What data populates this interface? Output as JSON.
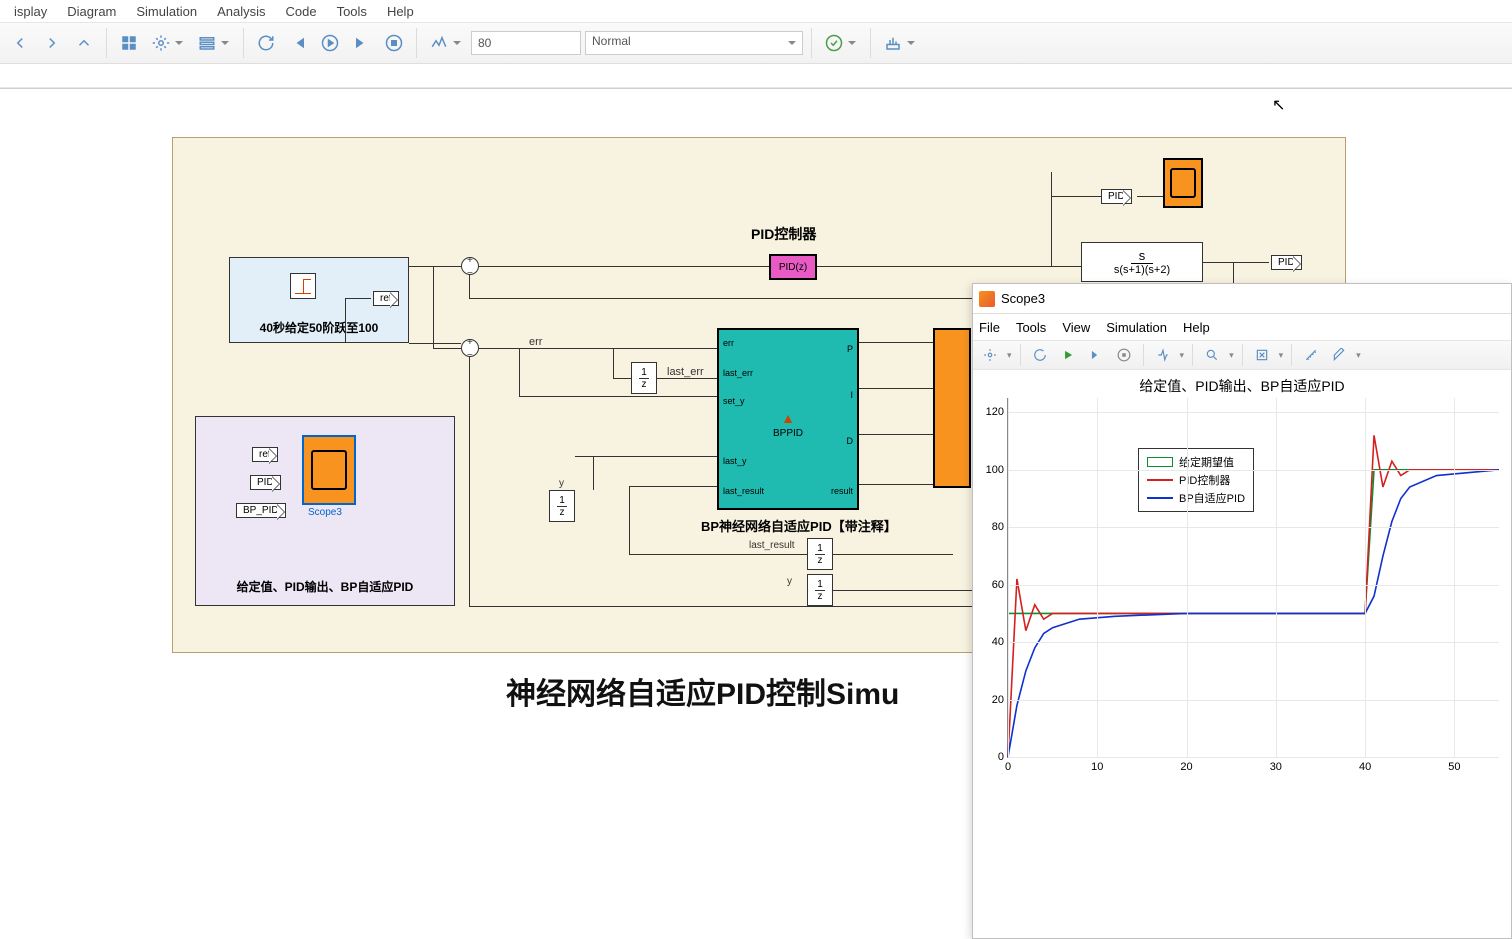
{
  "menu": {
    "items": [
      "isplay",
      "Diagram",
      "Simulation",
      "Analysis",
      "Code",
      "Tools",
      "Help"
    ]
  },
  "toolbar": {
    "stop_time": "80",
    "mode": "Normal"
  },
  "path": "",
  "model": {
    "title_big": "神经网络自适应PID控制Simu",
    "source_caption": "40秒给定50阶跃至100",
    "scope_caption": "给定值、PID输出、BP自适应PID",
    "scope_name": "Scope3",
    "pid_label": "PID控制器",
    "pid_block": "PID(z)",
    "bp_label": "BP神经网络自适应PID【带注释】",
    "bp_block": "BPPID",
    "tf_num": "s",
    "tf_den": "s(s+1)(s+2)",
    "tags": {
      "ref": "ref",
      "pid_out": "PID",
      "pid_in": "PID",
      "bp_pid": "BP_PID"
    },
    "ports": {
      "err": "err",
      "last_err": "last_err",
      "set_y": "set_y",
      "last_y": "last_y",
      "last_result": "last_result",
      "P": "P",
      "I": "I",
      "D": "D",
      "result": "result",
      "y": "y"
    }
  },
  "scope": {
    "window_title": "Scope3",
    "menu": [
      "File",
      "Tools",
      "View",
      "Simulation",
      "Help"
    ],
    "plot_title": "给定值、PID输出、BP自适应PID",
    "legend": [
      "给定期望值",
      "PID控制器",
      "BP自适应PID"
    ],
    "yticks": [
      0,
      20,
      40,
      60,
      80,
      100,
      120
    ],
    "xticks": [
      0,
      10,
      20,
      30,
      40,
      50
    ]
  },
  "chart_data": {
    "type": "line",
    "title": "给定值、PID输出、BP自适应PID",
    "xlabel": "",
    "ylabel": "",
    "xlim": [
      0,
      55
    ],
    "ylim": [
      0,
      125
    ],
    "x": [
      0,
      1,
      2,
      3,
      4,
      5,
      8,
      12,
      20,
      30,
      40,
      41,
      42,
      43,
      44,
      45,
      48,
      55
    ],
    "series": [
      {
        "name": "给定期望值",
        "color": "#0a8f2f",
        "values": [
          50,
          50,
          50,
          50,
          50,
          50,
          50,
          50,
          50,
          50,
          50,
          100,
          100,
          100,
          100,
          100,
          100,
          100
        ]
      },
      {
        "name": "PID控制器",
        "color": "#d42020",
        "values": [
          0,
          62,
          44,
          53,
          48,
          50,
          50,
          50,
          50,
          50,
          50,
          112,
          94,
          103,
          98,
          100,
          100,
          100
        ]
      },
      {
        "name": "BP自适应PID",
        "color": "#1030d0",
        "values": [
          0,
          18,
          30,
          38,
          43,
          45,
          48,
          49,
          50,
          50,
          50,
          56,
          70,
          82,
          90,
          94,
          98,
          100
        ]
      }
    ]
  }
}
